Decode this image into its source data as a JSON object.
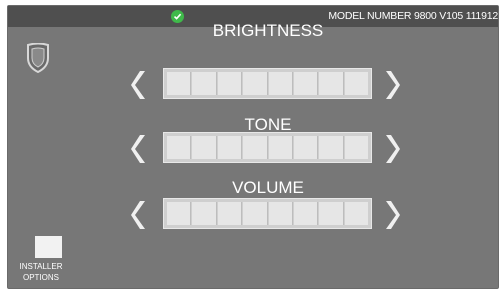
{
  "status": {
    "icon": "check-circle-icon",
    "color": "#3fb94a"
  },
  "header": {
    "model_text": "MODEL NUMBER 9800 V105 111912"
  },
  "settings": [
    {
      "title": "BRIGHTNESS",
      "segments": 8
    },
    {
      "title": "TONE",
      "segments": 8
    },
    {
      "title": "VOLUME",
      "segments": 8
    }
  ],
  "installer": {
    "label_line1": "INSTALLER",
    "label_line2": "OPTIONS"
  },
  "colors": {
    "panel": "#777777",
    "topbar": "#4f4f4f",
    "accent": "#3fb94a",
    "arrow": "#f0f0f0"
  }
}
